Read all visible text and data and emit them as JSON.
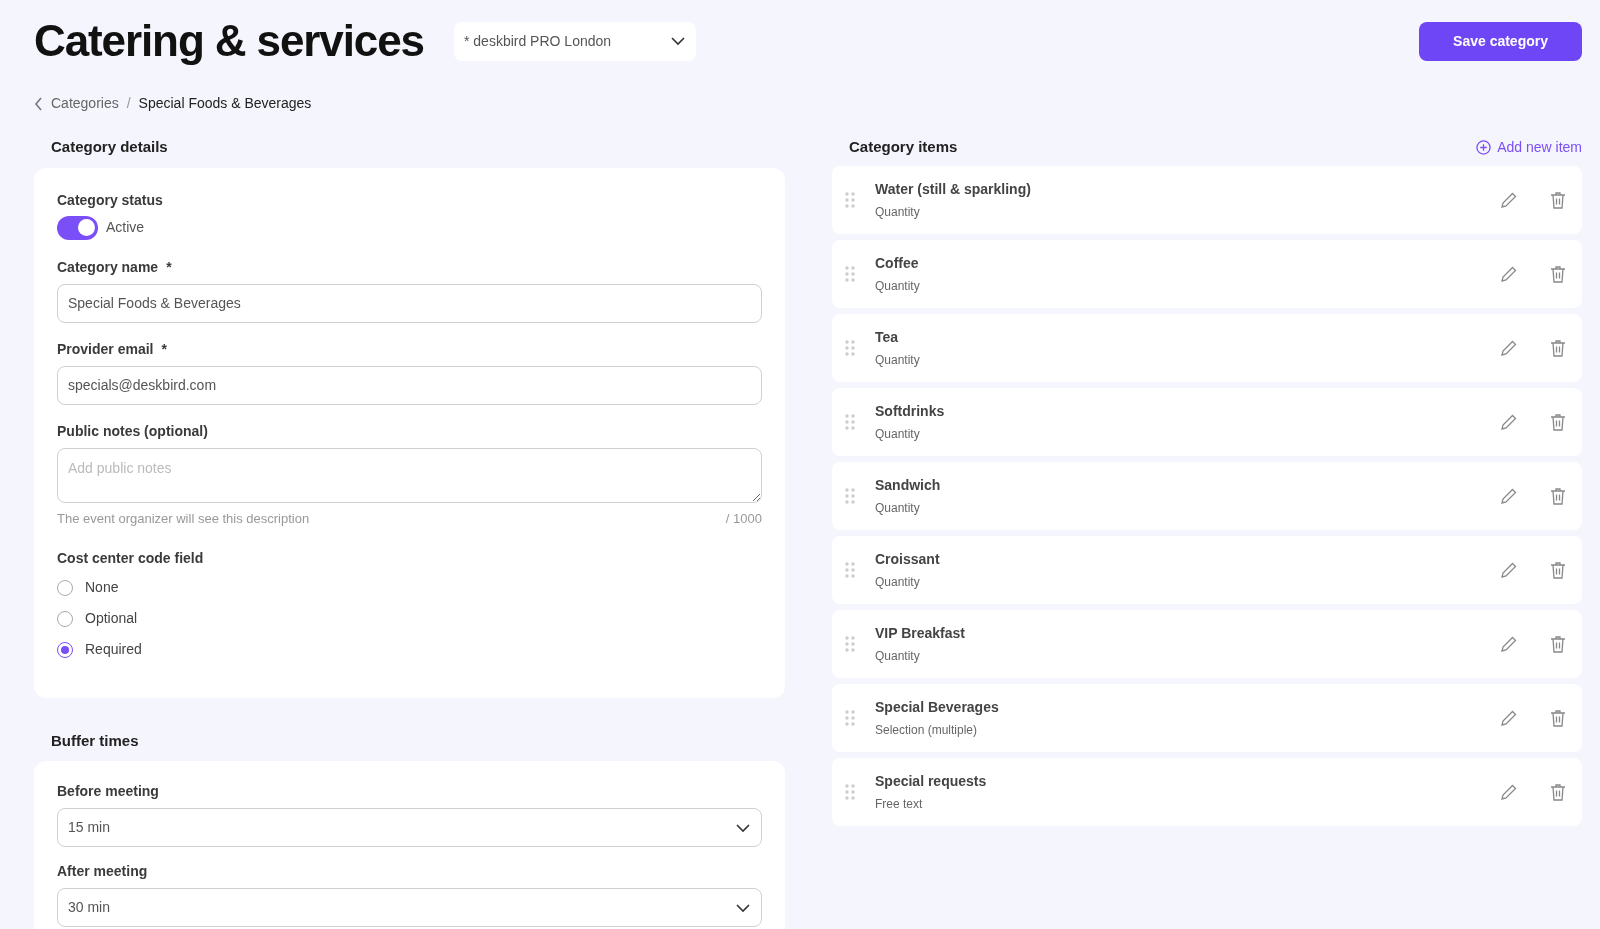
{
  "header": {
    "title": "Catering & services",
    "location_select": "* deskbird PRO London",
    "save_button": "Save category"
  },
  "breadcrumb": [
    "Categories",
    "Special Foods & Beverages"
  ],
  "breadcrumb_separator": "/",
  "category_details": {
    "title": "Category details",
    "status_label": "Category status",
    "status_on": true,
    "status_text": "Active",
    "name_label": "Category name",
    "name_required": "*",
    "name_value": "Special Foods & Beverages",
    "email_label": "Provider email",
    "email_required": "*",
    "email_value": "specials@deskbird.com",
    "notes_label": "Public notes (optional)",
    "notes_placeholder": "Add public notes",
    "notes_hint": "The event organizer will see this description",
    "notes_count": "/ 1000",
    "cost_center_label": "Cost center code field",
    "cost_center_options": [
      {
        "label": "None",
        "selected": false
      },
      {
        "label": "Optional",
        "selected": false
      },
      {
        "label": "Required",
        "selected": true
      }
    ]
  },
  "buffer_times": {
    "title": "Buffer times",
    "fields": [
      {
        "label": "Before meeting",
        "value": "15 min"
      },
      {
        "label": "After meeting",
        "value": "30 min"
      }
    ]
  },
  "category_items": {
    "title": "Category items",
    "add_link": "Add new item",
    "items": [
      {
        "name": "Water (still & sparkling)",
        "type": "Quantity"
      },
      {
        "name": "Coffee",
        "type": "Quantity"
      },
      {
        "name": "Tea",
        "type": "Quantity"
      },
      {
        "name": "Softdrinks",
        "type": "Quantity"
      },
      {
        "name": "Sandwich",
        "type": "Quantity"
      },
      {
        "name": "Croissant",
        "type": "Quantity"
      },
      {
        "name": "VIP Breakfast",
        "type": "Quantity"
      },
      {
        "name": "Special Beverages",
        "type": "Selection (multiple)"
      },
      {
        "name": "Special requests",
        "type": "Free text"
      }
    ]
  }
}
